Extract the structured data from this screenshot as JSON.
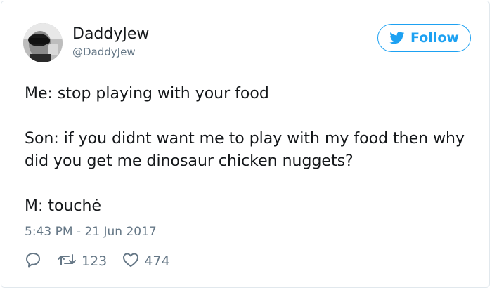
{
  "user": {
    "display_name": "DaddyJew",
    "handle": "@DaddyJew"
  },
  "follow_button": {
    "label": "Follow"
  },
  "tweet": {
    "lines": [
      "Me: stop playing with your food",
      "Son: if you didnt want me to play with my food then why did you get me dinosaur chicken nuggets?",
      "M: touchė"
    ],
    "timestamp": "5:43 PM - 21 Jun 2017"
  },
  "actions": {
    "retweet_count": "123",
    "like_count": "474"
  },
  "icons": {
    "follow": "twitter-bird-icon",
    "reply": "reply-icon",
    "retweet": "retweet-icon",
    "like": "heart-icon"
  },
  "colors": {
    "accent": "#1da1f2",
    "text": "#14171a",
    "muted": "#657786",
    "border": "#e1e8ed"
  }
}
